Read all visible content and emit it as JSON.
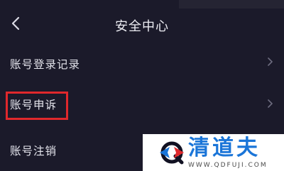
{
  "header": {
    "title": "安全中心",
    "back_icon": "chevron-left-icon"
  },
  "menu": {
    "items": [
      {
        "label": "账号登录记录",
        "icon": "chevron-right-icon"
      },
      {
        "label": "账号申诉",
        "icon": "chevron-right-icon",
        "highlighted": true
      },
      {
        "label": "账号注销"
      }
    ]
  },
  "watermark": {
    "brand": "清道夫",
    "url": "WWW.QDFUJI.COM"
  },
  "colors": {
    "background": "#1b1a2a",
    "text": "#e4e4ec",
    "highlight": "#e0282c",
    "watermark_blue": "#1a75d8"
  }
}
